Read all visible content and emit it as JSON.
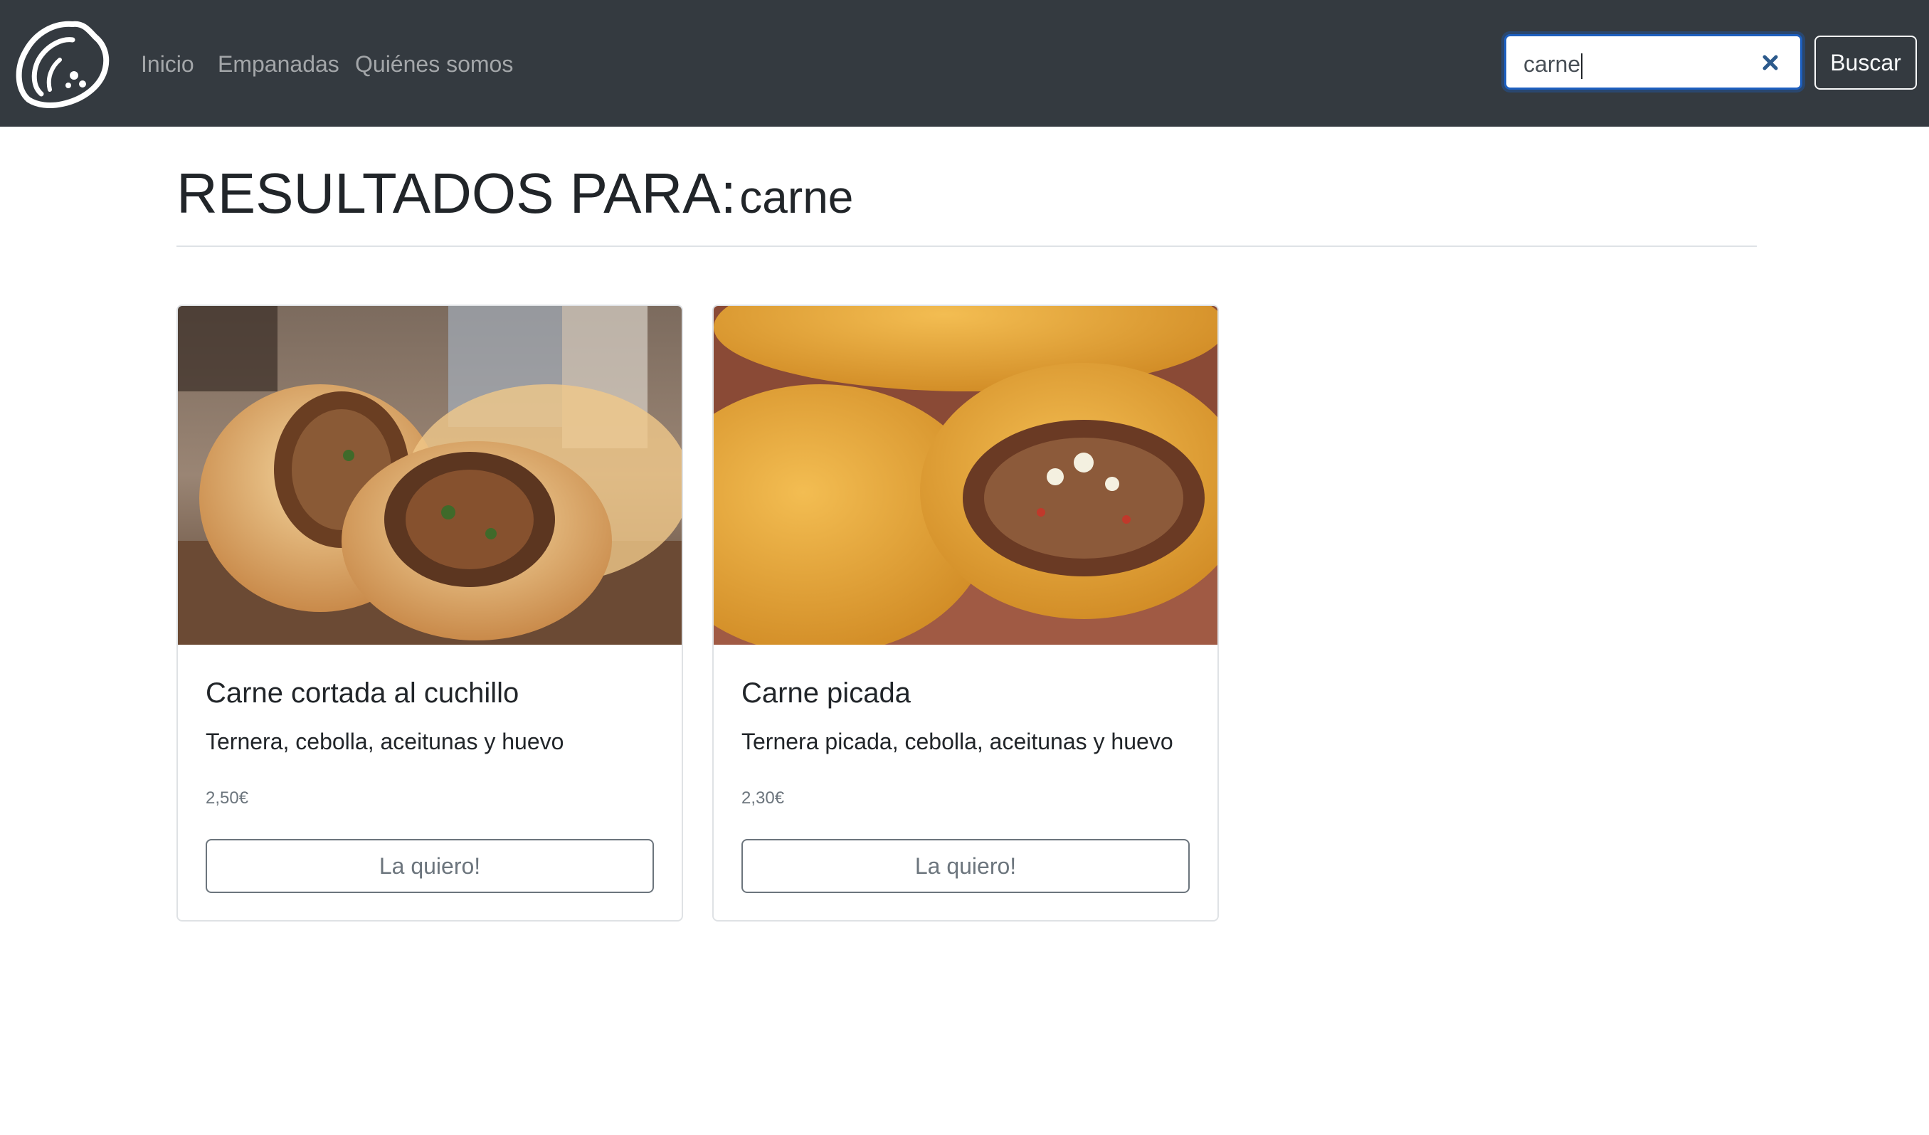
{
  "navbar": {
    "logo_icon": "empanada-logo-icon",
    "links": [
      {
        "label": "Inicio"
      },
      {
        "label": "Empanadas"
      },
      {
        "label": "Quiénes somos"
      }
    ],
    "search": {
      "value": "carne",
      "clear_icon": "close-x-icon",
      "button_label": "Buscar"
    }
  },
  "results": {
    "label": "RESULTADOS PARA:",
    "term": "carne"
  },
  "products": [
    {
      "title": "Carne cortada al cuchillo",
      "description": "Ternera, cebolla, aceitunas y huevo",
      "price": "2,50€",
      "button_label": "La quiero!"
    },
    {
      "title": "Carne picada",
      "description": "Ternera picada, cebolla, aceitunas y huevo",
      "price": "2,30€",
      "button_label": "La quiero!"
    }
  ],
  "colors": {
    "navbar_bg": "#343a40",
    "focus_border": "#1d5fbf",
    "muted": "#6c757d"
  }
}
